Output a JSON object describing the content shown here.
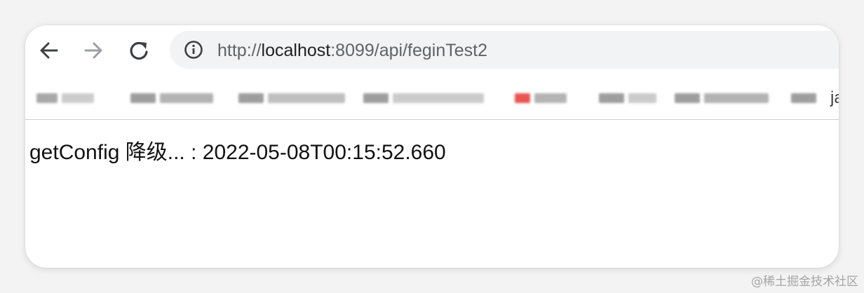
{
  "browser": {
    "address_bar": {
      "url_prefix": "http://",
      "url_host": "localhost",
      "url_rest": ":8099/api/feginTest2"
    },
    "bookmarks_bar": {
      "trailing_text": "ja"
    }
  },
  "page": {
    "body_text": "getConfig 降级... : 2022-05-08T00:15:52.660"
  },
  "watermark": "@稀土掘金技术社区",
  "colors": {
    "omnibox_bg": "#f1f3f4",
    "icon_dark": "#3c4043",
    "icon_disabled": "#9aa0a6",
    "bookmark_red": "#e53935"
  },
  "icons": {
    "back": "arrow-left",
    "forward": "arrow-right",
    "reload": "refresh",
    "site_info": "info-circle"
  }
}
